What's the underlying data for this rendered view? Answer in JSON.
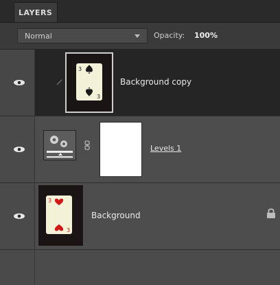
{
  "panel": {
    "tab_label": "LAYERS",
    "blend_mode": "Normal",
    "opacity_label": "Opacity:",
    "opacity_value": "100%"
  },
  "layers": [
    {
      "name": "Background copy",
      "selected": true,
      "visible": true,
      "thumb": "playing-card-spades"
    },
    {
      "name": "Levels 1",
      "selected": false,
      "visible": true,
      "thumb": "levels-adjustment",
      "has_mask": true,
      "linked": true
    },
    {
      "name": "Background",
      "selected": false,
      "visible": true,
      "thumb": "playing-card-hearts",
      "locked": true
    }
  ],
  "colors": {
    "panel_bg": "#4b4b4b",
    "selected_row": "#252525",
    "tabbar": "#2a2a2a",
    "card": "#f3f1d8",
    "heart": "#d01818",
    "spade": "#1a1a1a"
  }
}
